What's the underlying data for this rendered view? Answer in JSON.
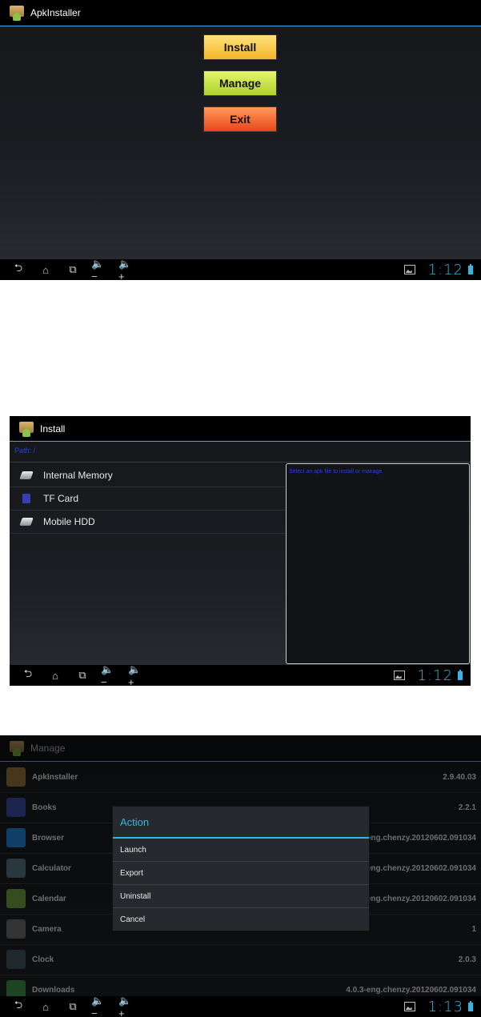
{
  "screen1": {
    "title": "ApkInstaller",
    "buttons": {
      "install": "Install",
      "manage": "Manage",
      "exit": "Exit"
    },
    "clock": "1:12",
    "colors": {
      "install": "#f5b52a",
      "manage": "#aed12a",
      "exit": "#e8461a",
      "accent": "#33b5e5"
    }
  },
  "screen2": {
    "title": "Install",
    "path": "Path: /",
    "items": [
      {
        "label": "Internal Memory",
        "icon": "drive-icon"
      },
      {
        "label": "TF Card",
        "icon": "sd-card-icon"
      },
      {
        "label": "Mobile HDD",
        "icon": "drive-icon"
      }
    ],
    "info_text": "Select an apk file to install or manage",
    "clock": "1:12"
  },
  "screen3": {
    "title": "Manage",
    "apps": [
      {
        "name": "ApkInstaller",
        "version": "2.9.40.03",
        "icon": "apk-installer-icon",
        "color": "#a57e3c"
      },
      {
        "name": "Books",
        "version": "2.2.1",
        "icon": "books-icon",
        "color": "#3f51b5"
      },
      {
        "name": "Browser",
        "version": "4.0.3-eng.chenzy.20120602.091034",
        "icon": "browser-icon",
        "color": "#2196f3"
      },
      {
        "name": "Calculator",
        "version": "4.0.3-eng.chenzy.20120602.091034",
        "icon": "calculator-icon",
        "color": "#607d8b"
      },
      {
        "name": "Calendar",
        "version": "4.0.3-eng.chenzy.20120602.091034",
        "icon": "calendar-icon",
        "color": "#7cb342"
      },
      {
        "name": "Camera",
        "version": "1",
        "icon": "camera-icon",
        "color": "#757575"
      },
      {
        "name": "Clock",
        "version": "2.0.3",
        "icon": "clock-icon",
        "color": "#455a64"
      },
      {
        "name": "Downloads",
        "version": "4.0.3-eng.chenzy.20120602.091034",
        "icon": "downloads-icon",
        "color": "#43a047"
      }
    ],
    "dialog": {
      "title": "Action",
      "items": [
        "Launch",
        "Export",
        "Uninstall",
        "Cancel"
      ]
    },
    "clock": "1:13"
  }
}
